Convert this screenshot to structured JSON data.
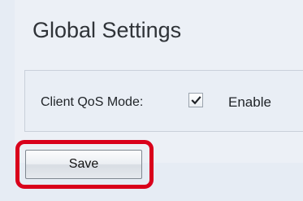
{
  "page": {
    "title": "Global Settings"
  },
  "settings": {
    "client_qos_mode_label": "Client QoS Mode:",
    "client_qos_mode_checked": true,
    "enable_label": "Enable"
  },
  "actions": {
    "save_label": "Save"
  },
  "icons": {
    "checkbox_mark": "checkmark-icon",
    "highlight": "red-highlight-outline"
  },
  "colors": {
    "background": "#e6ecf4",
    "highlight": "#d9001b",
    "text": "#1f2327"
  }
}
